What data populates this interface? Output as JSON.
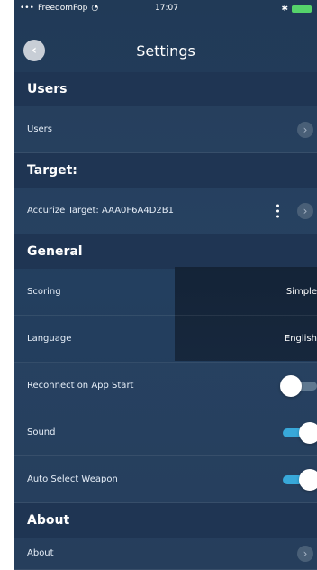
{
  "statusbar": {
    "carrier": "FreedomPop",
    "time": "17:07"
  },
  "header": {
    "title": "Settings",
    "back_icon": "chevron-left-icon"
  },
  "sections": {
    "users": {
      "label": "Users"
    },
    "target": {
      "label": "Target:"
    },
    "general": {
      "label": "General"
    },
    "about": {
      "label": "About"
    }
  },
  "rows": {
    "users": {
      "label": "Users"
    },
    "accurize_target": {
      "label": "Accurize Target: AAA0F6A4D2B1"
    },
    "scoring": {
      "label": "Scoring",
      "value": "Simple"
    },
    "language": {
      "label": "Language",
      "value": "English"
    },
    "reconnect": {
      "label": "Reconnect on App Start",
      "state": "off"
    },
    "sound": {
      "label": "Sound",
      "state": "on"
    },
    "auto_select": {
      "label": "Auto Select Weapon",
      "state": "on"
    },
    "about": {
      "label": "About"
    }
  },
  "colors": {
    "background": "#223b59",
    "section": "#1f3553",
    "toggle_on": "#38a8d9"
  }
}
